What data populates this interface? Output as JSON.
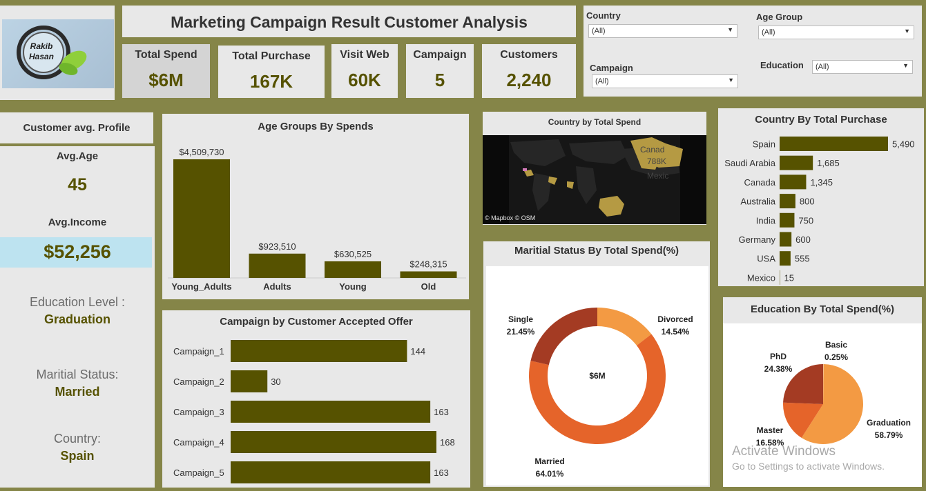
{
  "logo": {
    "line1": "Rakib",
    "line2": "Hasan"
  },
  "title": "Marketing Campaign Result  Customer Analysis",
  "kpis": [
    {
      "label": "Total Spend",
      "value": "$6M"
    },
    {
      "label": "Total Purchase",
      "value": "167K"
    },
    {
      "label": "Visit Web",
      "value": "60K"
    },
    {
      "label": "Campaign",
      "value": "5"
    },
    {
      "label": "Customers",
      "value": "2,240"
    }
  ],
  "filters": {
    "country": {
      "label": "Country",
      "value": "(All)"
    },
    "age_group": {
      "label": "Age Group",
      "value": "(All)"
    },
    "campaign": {
      "label": "Campaign",
      "value": "(All)"
    },
    "education": {
      "label": "Education",
      "value": "(All)"
    }
  },
  "profile": {
    "title": "Customer  avg. Profile",
    "avg_age_label": "Avg.Age",
    "avg_age": "45",
    "avg_income_label": "Avg.Income",
    "avg_income": "$52,256",
    "education_label": "Education Level :",
    "education": "Graduation",
    "marital_label": "Maritial Status:",
    "marital": "Married",
    "country_label": "Country:",
    "country": "Spain"
  },
  "map": {
    "title": "Country by Total Spend",
    "attribution": "© Mapbox © OSM",
    "labels": [
      "Canad",
      "788K",
      "Mexic"
    ]
  },
  "colors": {
    "bar": "#565200",
    "accent_blue": "#bde3f0",
    "single": "#a43b23",
    "divorced": "#f39a43",
    "married": "#e5642a",
    "phd": "#a43b23",
    "master": "#e5642a",
    "graduation": "#f39a43",
    "basic": "#f7c190"
  },
  "watermark": {
    "line1": "Activate Windows",
    "line2": "Go to Settings to activate Windows."
  },
  "chart_data": [
    {
      "id": "age",
      "type": "bar",
      "title": "Age Groups By Spends",
      "categories": [
        "Young_Adults",
        "Adults",
        "Young",
        "Old"
      ],
      "values": [
        4509730,
        923510,
        630525,
        248315
      ],
      "labels": [
        "$4,509,730",
        "$923,510",
        "$630,525",
        "$248,315"
      ]
    },
    {
      "id": "campaign",
      "type": "bar",
      "orientation": "horizontal",
      "title": "Campaign by Customer Accepted Offer",
      "categories": [
        "Campaign_1",
        "Campaign_2",
        "Campaign_3",
        "Campaign_4",
        "Campaign_5"
      ],
      "values": [
        144,
        30,
        163,
        168,
        163
      ]
    },
    {
      "id": "country",
      "type": "bar",
      "orientation": "horizontal",
      "title": "Country By Total Purchase",
      "categories": [
        "Spain",
        "Saudi Arabia",
        "Canada",
        "Australia",
        "India",
        "Germany",
        "USA",
        "Mexico"
      ],
      "values": [
        5490,
        1685,
        1345,
        800,
        750,
        600,
        555,
        15
      ],
      "labels": [
        "5,490",
        "1,685",
        "1,345",
        "800",
        "750",
        "600",
        "555",
        "15"
      ]
    },
    {
      "id": "marital",
      "type": "pie",
      "title": "Maritial Status By Total Spend(%)",
      "center_label": "$6M",
      "slices": [
        {
          "name": "Divorced",
          "value": 14.54,
          "label": "14.54%"
        },
        {
          "name": "Married",
          "value": 64.01,
          "label": "64.01%"
        },
        {
          "name": "Single",
          "value": 21.45,
          "label": "21.45%"
        }
      ]
    },
    {
      "id": "education",
      "type": "pie",
      "title": "Education By Total Spend(%)",
      "slices": [
        {
          "name": "Basic",
          "value": 0.25,
          "label": "0.25%"
        },
        {
          "name": "Graduation",
          "value": 58.79,
          "label": "58.79%"
        },
        {
          "name": "Master",
          "value": 16.58,
          "label": "16.58%"
        },
        {
          "name": "PhD",
          "value": 24.38,
          "label": "24.38%"
        }
      ]
    }
  ]
}
